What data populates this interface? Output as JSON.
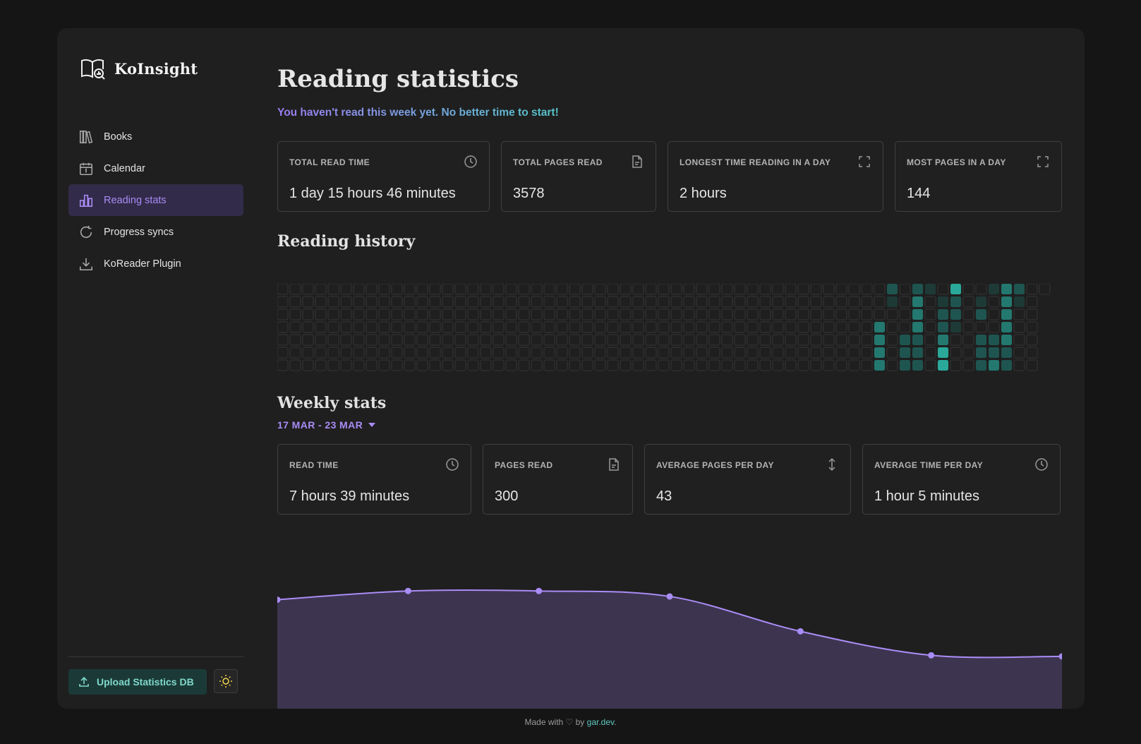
{
  "app": {
    "name": "KoInsight"
  },
  "sidebar": {
    "items": [
      {
        "label": "Books",
        "icon": "books-icon",
        "active": false
      },
      {
        "label": "Calendar",
        "icon": "calendar-icon",
        "active": false
      },
      {
        "label": "Reading stats",
        "icon": "bar-chart-icon",
        "active": true
      },
      {
        "label": "Progress syncs",
        "icon": "refresh-icon",
        "active": false
      },
      {
        "label": "KoReader Plugin",
        "icon": "download-icon",
        "active": false
      }
    ],
    "upload_label": "Upload Statistics DB",
    "theme_icon": "sun-icon"
  },
  "page": {
    "title": "Reading statistics",
    "subtitle": "You haven't read this week yet. No better time to start!"
  },
  "totals": [
    {
      "label": "TOTAL READ TIME",
      "value": "1 day 15 hours 46 minutes",
      "icon": "clock-icon"
    },
    {
      "label": "TOTAL PAGES READ",
      "value": "3578",
      "icon": "file-icon"
    },
    {
      "label": "LONGEST TIME READING IN A DAY",
      "value": "2 hours",
      "icon": "expand-icon"
    },
    {
      "label": "MOST PAGES IN A DAY",
      "value": "144",
      "icon": "expand-icon"
    }
  ],
  "history": {
    "title": "Reading history",
    "weeks": 61,
    "days_per_week": 7,
    "active_cells": [
      [
        47,
        3,
        3
      ],
      [
        47,
        4,
        3
      ],
      [
        47,
        5,
        3
      ],
      [
        47,
        6,
        3
      ],
      [
        48,
        0,
        2
      ],
      [
        48,
        1,
        1
      ],
      [
        49,
        4,
        2
      ],
      [
        49,
        5,
        2
      ],
      [
        49,
        6,
        2
      ],
      [
        50,
        0,
        2
      ],
      [
        50,
        1,
        3
      ],
      [
        50,
        2,
        3
      ],
      [
        50,
        3,
        3
      ],
      [
        50,
        4,
        2
      ],
      [
        50,
        5,
        2
      ],
      [
        50,
        6,
        2
      ],
      [
        51,
        0,
        1
      ],
      [
        52,
        1,
        1
      ],
      [
        52,
        2,
        2
      ],
      [
        52,
        3,
        2
      ],
      [
        52,
        4,
        3
      ],
      [
        52,
        5,
        4
      ],
      [
        52,
        6,
        4
      ],
      [
        53,
        0,
        4
      ],
      [
        53,
        1,
        2
      ],
      [
        53,
        2,
        2
      ],
      [
        53,
        3,
        1
      ],
      [
        55,
        1,
        1
      ],
      [
        55,
        2,
        2
      ],
      [
        55,
        4,
        2
      ],
      [
        55,
        5,
        2
      ],
      [
        55,
        6,
        2
      ],
      [
        56,
        0,
        1
      ],
      [
        56,
        4,
        2
      ],
      [
        56,
        5,
        2
      ],
      [
        56,
        6,
        3
      ],
      [
        57,
        0,
        3
      ],
      [
        57,
        1,
        3
      ],
      [
        57,
        2,
        3
      ],
      [
        57,
        3,
        3
      ],
      [
        57,
        4,
        3
      ],
      [
        57,
        5,
        2
      ],
      [
        57,
        6,
        2
      ],
      [
        58,
        0,
        2
      ],
      [
        58,
        1,
        1
      ]
    ],
    "colors": [
      "#262626",
      "#1e3a36",
      "#1f5550",
      "#23786f",
      "#2aa899"
    ]
  },
  "weekly": {
    "title": "Weekly stats",
    "range_label": "17 MAR - 23 MAR",
    "cards": [
      {
        "label": "READ TIME",
        "value": "7 hours 39 minutes",
        "icon": "clock-icon"
      },
      {
        "label": "PAGES READ",
        "value": "300",
        "icon": "file-icon"
      },
      {
        "label": "AVERAGE PAGES PER DAY",
        "value": "43",
        "icon": "vertical-arrows-icon"
      },
      {
        "label": "AVERAGE TIME PER DAY",
        "value": "1 hour 5 minutes",
        "icon": "clock-icon"
      }
    ]
  },
  "chart_data": {
    "type": "area",
    "x": [
      1,
      2,
      3,
      4,
      5,
      6,
      7
    ],
    "values": [
      100,
      108,
      108,
      103,
      71,
      49,
      48
    ],
    "ylim": [
      0,
      147
    ],
    "color": "#a98cf5",
    "fill": "#3d3550"
  },
  "footer": {
    "prefix": "Made with ♡ by ",
    "link": "gar.dev",
    "suffix": "."
  }
}
